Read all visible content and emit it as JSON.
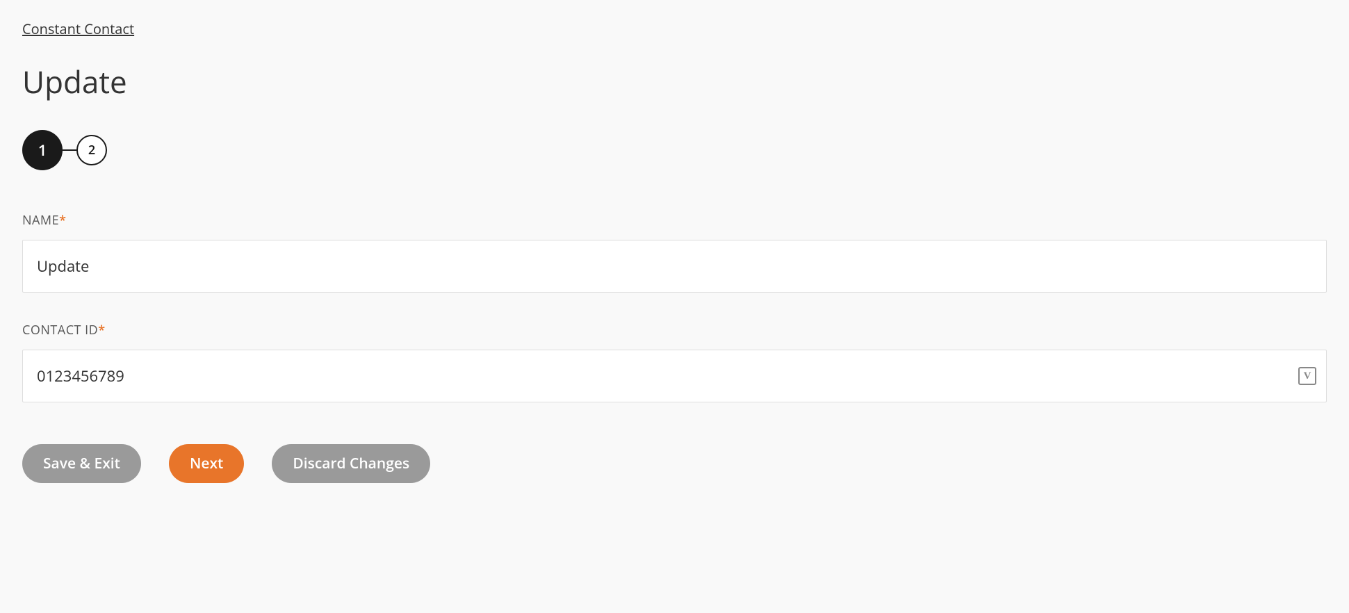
{
  "breadcrumb": "Constant Contact",
  "page_title": "Update",
  "stepper": {
    "steps": [
      "1",
      "2"
    ],
    "active_index": 0
  },
  "form": {
    "name": {
      "label": "NAME",
      "required_mark": "*",
      "value": "Update"
    },
    "contact_id": {
      "label": "CONTACT ID",
      "required_mark": "*",
      "value": "0123456789",
      "suffix_icon_text": "V"
    }
  },
  "buttons": {
    "save_exit": "Save & Exit",
    "next": "Next",
    "discard": "Discard Changes"
  }
}
